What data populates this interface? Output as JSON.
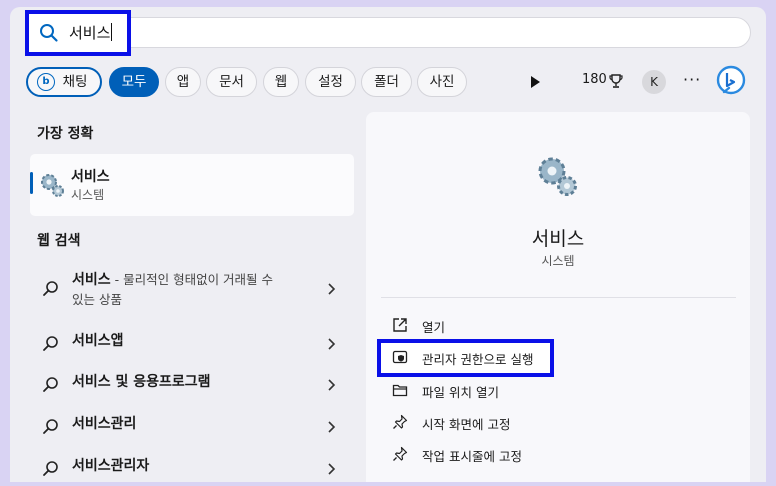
{
  "search": {
    "query": "서비스"
  },
  "filters": [
    {
      "label": "채팅"
    },
    {
      "label": "모두"
    },
    {
      "label": "앱"
    },
    {
      "label": "문서"
    },
    {
      "label": "웹"
    },
    {
      "label": "설정"
    },
    {
      "label": "폴더"
    },
    {
      "label": "사진"
    }
  ],
  "toolbar": {
    "points": "180",
    "avatar_initial": "K",
    "more": "···"
  },
  "left": {
    "best_match_title": "가장 정확",
    "best_match": {
      "name": "서비스",
      "type": "시스템"
    },
    "web_search_title": "웹 검색",
    "web_results": [
      {
        "bold": "서비스",
        "rest": " - 물리적인 형태없이 거래될 수",
        "line2": "있는 상품"
      },
      {
        "bold": "서비스앱"
      },
      {
        "bold": "서비스 및 응용프로그램"
      },
      {
        "bold": "서비스관리"
      },
      {
        "bold": "서비스관리자"
      }
    ]
  },
  "right": {
    "name": "서비스",
    "type": "시스템",
    "actions": [
      {
        "label": "열기",
        "icon": "open-external-icon"
      },
      {
        "label": "관리자 권한으로 실행",
        "icon": "shield-icon"
      },
      {
        "label": "파일 위치 열기",
        "icon": "folder-icon"
      },
      {
        "label": "시작 화면에 고정",
        "icon": "pin-icon"
      },
      {
        "label": "작업 표시줄에 고정",
        "icon": "pin-icon"
      }
    ]
  },
  "colors": {
    "accent": "#005fb8",
    "highlight": "#0a10e8",
    "backdrop": "#d9d3f3"
  }
}
